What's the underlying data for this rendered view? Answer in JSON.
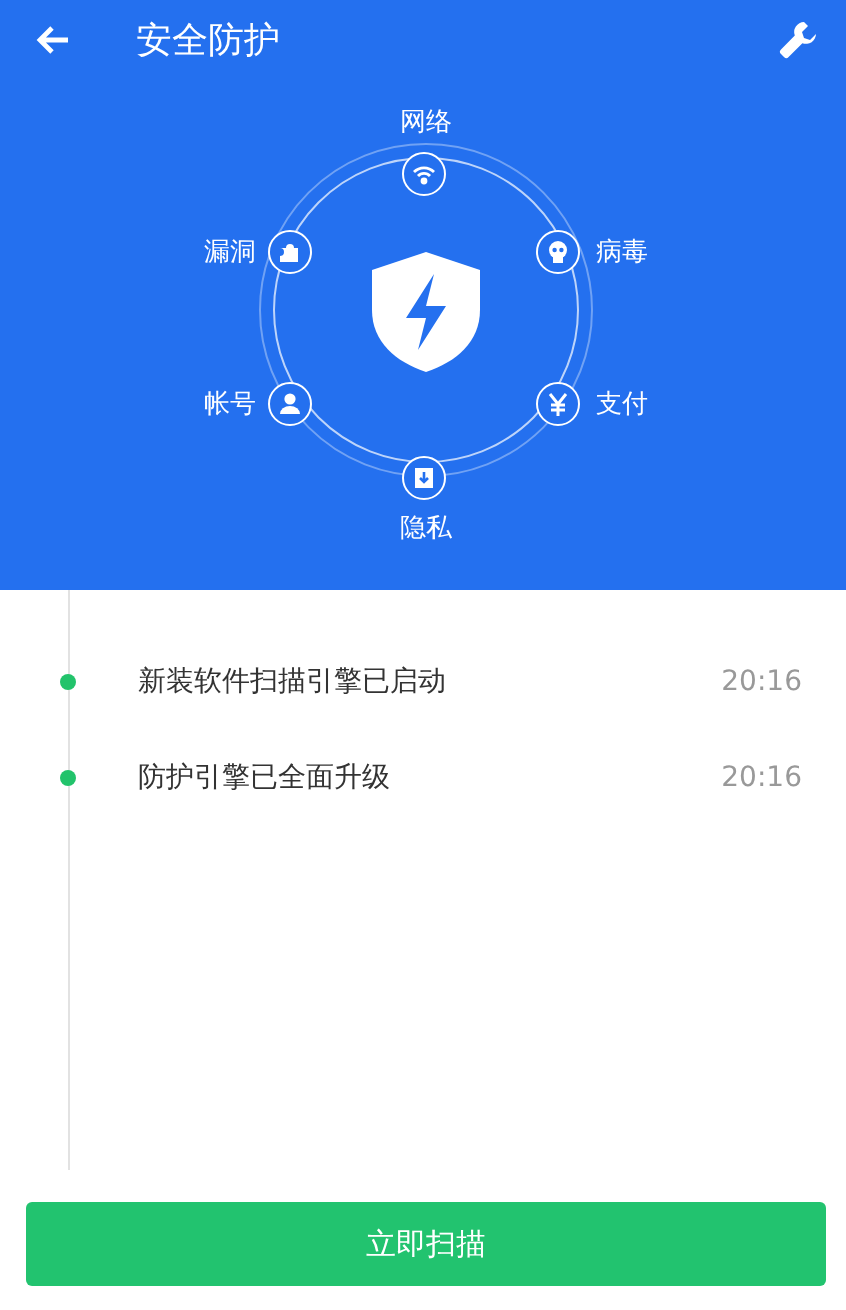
{
  "header": {
    "title": "安全防护"
  },
  "scan_nodes": [
    {
      "label": "网络"
    },
    {
      "label": "病毒"
    },
    {
      "label": "支付"
    },
    {
      "label": "隐私"
    },
    {
      "label": "帐号"
    },
    {
      "label": "漏洞"
    }
  ],
  "timeline": [
    {
      "text": "新装软件扫描引擎已启动",
      "time": "20:16"
    },
    {
      "text": "防护引擎已全面升级",
      "time": "20:16"
    }
  ],
  "scan_button": {
    "label": "立即扫描"
  }
}
